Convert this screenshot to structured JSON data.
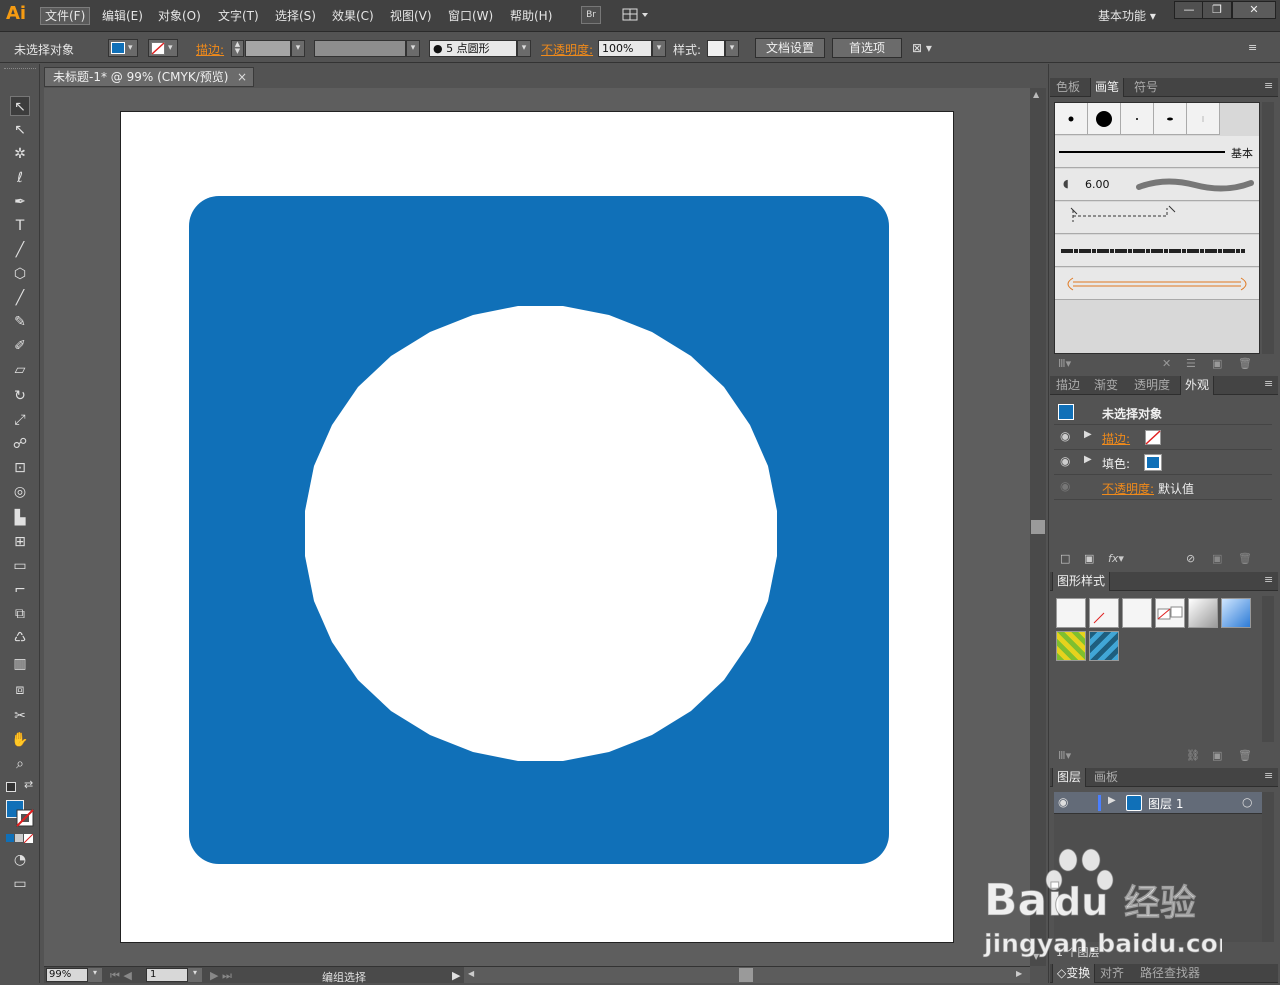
{
  "app": {
    "logo": "Ai",
    "menus": [
      "文件(F)",
      "编辑(E)",
      "对象(O)",
      "文字(T)",
      "选择(S)",
      "效果(C)",
      "视图(V)",
      "窗口(W)",
      "帮助(H)"
    ],
    "bridge_label": "Br",
    "workspace_label": "基本功能",
    "window_controls": [
      "—",
      "❐",
      "✕"
    ]
  },
  "control": {
    "selection_label": "未选择对象",
    "stroke_label": "描边:",
    "brush_size": "5",
    "brush_shape": "点圆形",
    "opacity_label": "不透明度:",
    "opacity_value": "100%",
    "style_label": "样式:",
    "doc_setup_button": "文档设置",
    "prefs_button": "首选项"
  },
  "document": {
    "tab_title": "未标题-1* @ 99% (CMYK/预览)",
    "tab_close": "×",
    "zoom": "99%",
    "artboard_num": "1",
    "status": "编组选择"
  },
  "colors": {
    "fill": "#1070b8",
    "accent": "#f08a1a"
  },
  "panels": {
    "brush_group_tabs": [
      "色板",
      "画笔",
      "符号"
    ],
    "brush_active": "画笔",
    "brush_basic_label": "基本",
    "brush_size_label": "6.00",
    "appearance_tabs": [
      "描边",
      "渐变",
      "透明度",
      "外观"
    ],
    "appearance_active": "外观",
    "appearance_title": "未选择对象",
    "appearance_rows": [
      {
        "label": "描边:",
        "value": ""
      },
      {
        "label": "填色:",
        "value": ""
      },
      {
        "label": "不透明度:",
        "value": "默认值"
      }
    ],
    "graphic_styles_tab": "图形样式",
    "layers_tabs": [
      "图层",
      "画板"
    ],
    "layer_name": "图层 1",
    "layer_count": "1 个图层",
    "bottom_tabs": [
      "变换",
      "对齐",
      "路径查找器"
    ]
  },
  "watermark": {
    "brand": "Bai du 经验",
    "url": "jingyan.baidu.com"
  }
}
